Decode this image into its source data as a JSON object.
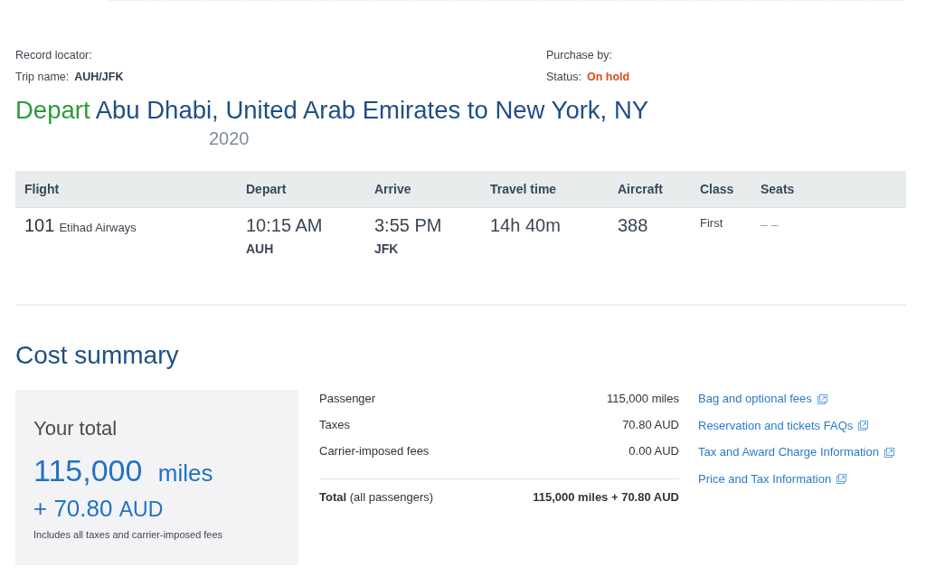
{
  "trip_info": {
    "record_locator": {
      "label": "Record locator:"
    },
    "purchase_by": {
      "label": "Purchase by:"
    },
    "trip_name": {
      "label": "Trip name:",
      "value": "AUH/JFK"
    },
    "status": {
      "label": "Status:",
      "value": "On hold"
    }
  },
  "heading": {
    "direction": "Depart",
    "route": "Abu Dhabi, United Arab Emirates to New York, NY",
    "date": "2020"
  },
  "flights_table": {
    "columns": [
      "Flight",
      "Depart",
      "Arrive",
      "Travel time",
      "Aircraft",
      "Class",
      "Seats"
    ],
    "rows": [
      {
        "flight_number": "101",
        "airline": "Etihad Airways",
        "depart_time": "10:15 AM",
        "depart_airport": "AUH",
        "arrive_time": "3:55 PM",
        "arrive_airport": "JFK",
        "travel_time": "14h 40m",
        "aircraft": "388",
        "class": "First",
        "seats": "– –"
      }
    ]
  },
  "cost_summary": {
    "title": "Cost summary",
    "total_box": {
      "label": "Your total",
      "miles": "115,000",
      "miles_unit": "miles",
      "cash": "+ 70.80",
      "currency": "AUD",
      "note": "Includes all taxes and carrier-imposed fees"
    },
    "breakdown": [
      {
        "label": "Passenger",
        "amount": "115,000 miles"
      },
      {
        "label": "Taxes",
        "amount": "70.80 AUD"
      },
      {
        "label": "Carrier-imposed fees",
        "amount": "0.00 AUD"
      }
    ],
    "total": {
      "label": "**Total** (all passengers)",
      "amount": "115,000 miles + 70.80 AUD"
    },
    "links": [
      {
        "label": "Bag and optional fees",
        "external": true
      },
      {
        "label": "Reservation and tickets FAQs",
        "external": true
      },
      {
        "label": "Tax and Award Charge Information",
        "external": true
      },
      {
        "label": "Price and Tax Information",
        "external": true
      }
    ]
  }
}
